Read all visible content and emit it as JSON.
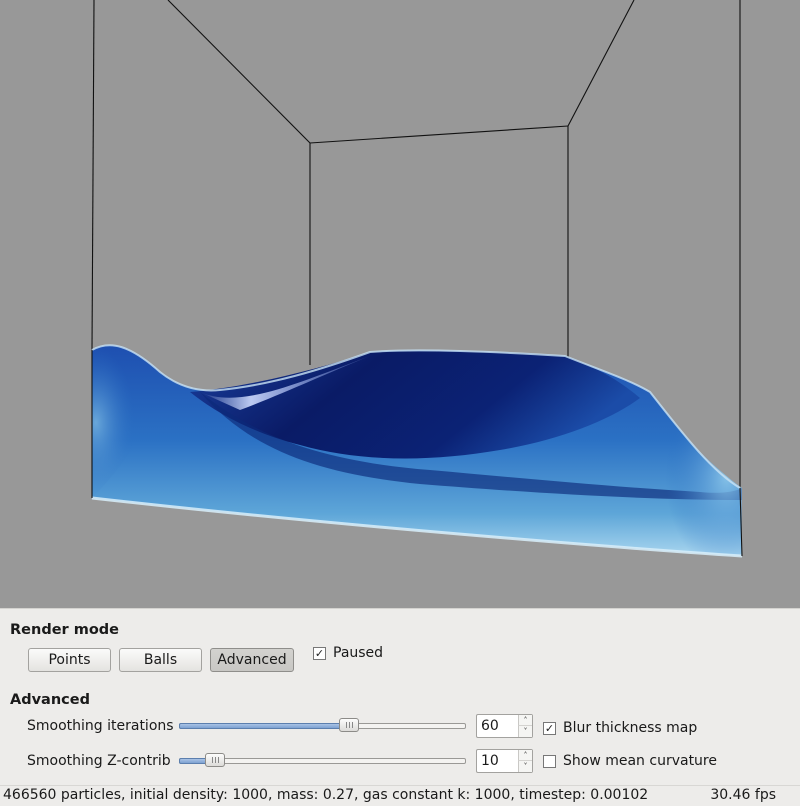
{
  "render_mode": {
    "title": "Render mode",
    "buttons": [
      "Points",
      "Balls",
      "Advanced"
    ],
    "active": "Advanced",
    "paused_label": "Paused",
    "paused": true
  },
  "advanced": {
    "title": "Advanced",
    "smoothing_iterations": {
      "label": "Smoothing iterations",
      "value": "60",
      "slider_fraction": 0.6
    },
    "smoothing_z": {
      "label": "Smoothing Z-contrib",
      "value": "10",
      "slider_fraction": 0.1
    },
    "blur_label": "Blur thickness map",
    "blur_checked": true,
    "curvature_label": "Show mean curvature",
    "curvature_checked": false
  },
  "status": {
    "message": "466560 particles, initial density: 1000, mass: 0.27, gas constant k: 1000, timestep: 0.00102",
    "fps": "30.46 fps"
  },
  "colors": {
    "viewport_bg": "#989898",
    "water_deep": "#0a1f6e",
    "water_mid": "#1f56b8",
    "water_light": "#7ab8e2",
    "panel_bg": "#edecea"
  },
  "icons": {
    "checkmark": "✓",
    "spin_up": "˄",
    "spin_down": "˅"
  }
}
